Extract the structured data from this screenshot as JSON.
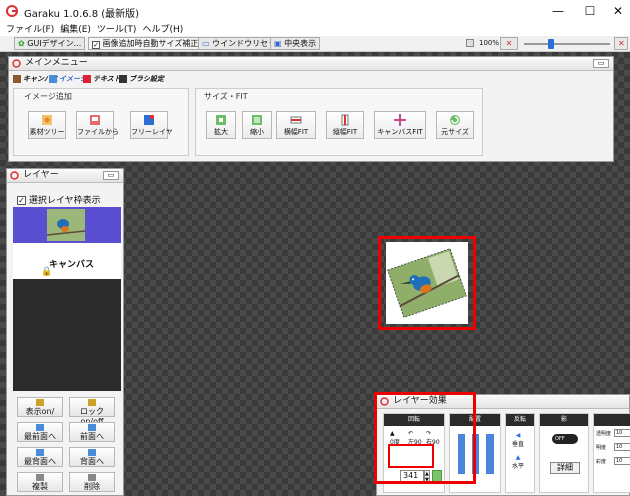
{
  "window": {
    "title": "Garaku 1.0.6.8 (最新版)",
    "min_glyph": "—",
    "max_glyph": "☐",
    "close_glyph": "✕"
  },
  "menubar": [
    "ファイル(F)",
    "編集(E)",
    "ツール(T)",
    "ヘルプ(H)"
  ],
  "toolbar": {
    "gui_design": "GUIデザイン...",
    "auto_size": "画像追加時自動サイズ補正",
    "auto_size_checked": true,
    "window_reset": "ウインドウリセット",
    "center_view": "中央表示",
    "zoom": "100%",
    "zoom_level": 0.4
  },
  "main_menu": {
    "title": "メインメニュー",
    "tabs": [
      "キャンバス",
      "イメージ",
      "テキスト",
      "ブラシ設定"
    ],
    "image_add": {
      "label": "イメージ追加",
      "buttons": [
        "素材ツリー",
        "ファイルから",
        "フリーレイヤ"
      ]
    },
    "size_fit": {
      "label": "サイズ・FIT",
      "buttons": [
        "拡大",
        "縮小",
        "横幅FIT",
        "縦幅FIT",
        "キャンバスFIT",
        "元サイズ"
      ]
    }
  },
  "layer_panel": {
    "title": "レイヤー",
    "show_frame": "選択レイヤ枠表示",
    "show_frame_checked": true,
    "canvas_label": "キャンバス",
    "buttons": [
      "表示on/",
      "ロックon/off",
      "最前面へ",
      "前面へ",
      "最背面へ",
      "背面へ",
      "複製",
      "削除"
    ]
  },
  "layer_effect": {
    "title": "レイヤー効果",
    "sections": [
      "回転",
      "配置",
      "反転",
      "影"
    ],
    "rotate_labels": [
      "0度",
      "左90",
      "右90"
    ],
    "rotate_value": "341",
    "flip_labels": [
      "垂直",
      "水平"
    ],
    "shadow_toggle": "OFF",
    "shadow_detail": "詳細",
    "props": [
      {
        "label": "透明度",
        "value": "10"
      },
      {
        "label": "明度",
        "value": "10"
      },
      {
        "label": "彩度",
        "value": "10"
      }
    ]
  },
  "colors": {
    "highlight": "#e00000",
    "selected_layer": "#5a4fd0",
    "bird_blue": "#1f6fb8",
    "bird_orange": "#d9761f"
  }
}
